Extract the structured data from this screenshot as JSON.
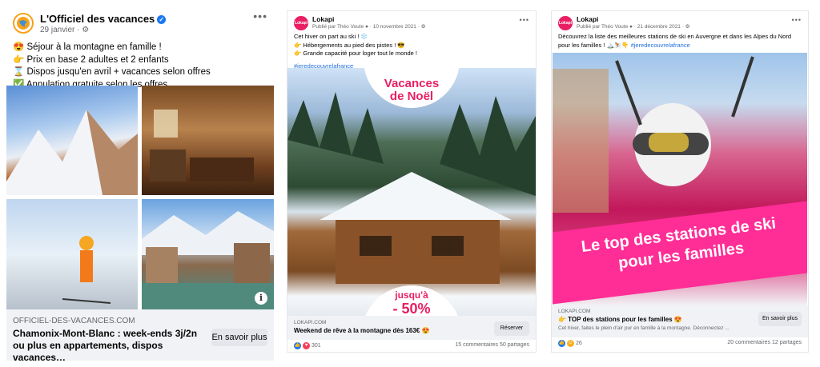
{
  "post1": {
    "page_name": "L'Officiel des vacances",
    "date": "29 janvier · ⚙",
    "lines": [
      "😍 Séjour à la montagne en famille !",
      "👉 Prix en base 2 adultes et 2 enfants",
      "⌛ Dispos jusqu'en avril + vacances selon offres",
      "✅ Annulation gratuite selon les offres"
    ],
    "domain": "OFFICIEL-DES-VACANCES.COM",
    "link_title": "Chamonix-Mont-Blanc : week-ends 3j/2n ou plus en appartements, dispos vacances…",
    "cta": "En savoir plus",
    "info_glyph": "i"
  },
  "post2": {
    "avatar_text": "Lokapi",
    "page_name": "Lokapi",
    "meta": "Publié par Théo Voute ● · 10 novembre 2021 · ⚙",
    "lines": [
      "Cet hiver on part au ski ! ❄️",
      "👉 Hébergements au pied des pistes ! 😎",
      "👉 Grande capacité pour loger tout le monde !"
    ],
    "hashtag": "#jeredecouvrelafrance",
    "badge_top": [
      "Vacances",
      "de Noël"
    ],
    "badge_bottom": [
      "jusqu'à",
      "- 50%"
    ],
    "domain": "LOKAPI.COM",
    "link_title": "Weekend de rêve à la montagne dès 163€ 😍",
    "cta": "Réserver",
    "reactions": "301",
    "comments": "15 commentaires",
    "shares": "50 partages"
  },
  "post3": {
    "avatar_text": "Lokapi",
    "page_name": "Lokapi",
    "meta": "Publié par Théo Voute ● · 21 décembre 2021 · ⚙",
    "line": "Découvrez la liste des meilleures stations de ski en Auvergne et dans les Alpes du Nord pour les familles ! 🏔️⛷️👇",
    "hashtag": "#jeredecouvrelafrance",
    "banner": [
      "Le top des stations de ski",
      "pour les familles"
    ],
    "domain": "LOKAPI.COM",
    "link_title": "👉 TOP des stations pour les familles 😍",
    "desc": "Cet hiver, faites le plein d'air pur en famille à la montagne. Déconnectez ...",
    "cta": "En savoir plus",
    "reactions": "26",
    "comments": "20 commentaires",
    "shares": "12 partages"
  },
  "more_glyph": "•••",
  "colors": {
    "brand_pink": "#e91e63",
    "banner_pink": "#ff2d96",
    "fb_blue": "#1877f2"
  }
}
